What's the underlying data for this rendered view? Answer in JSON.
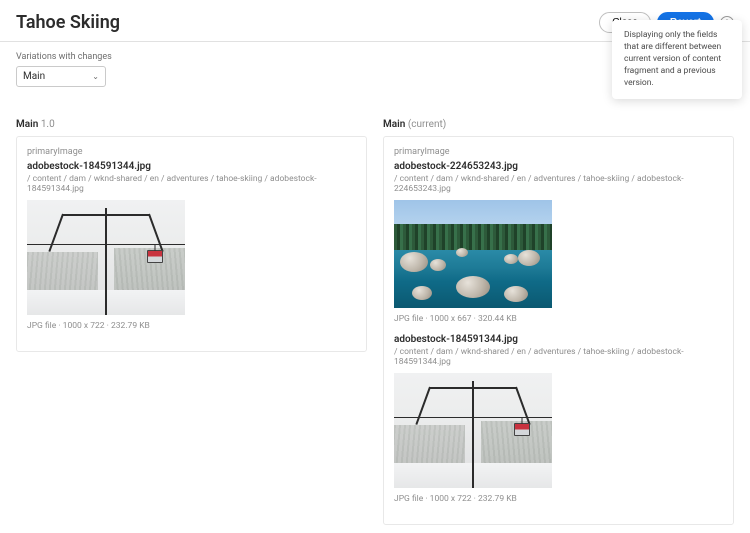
{
  "header": {
    "title": "Tahoe Skiing",
    "close_label": "Close",
    "revert_label": "Revert",
    "tooltip": "Displaying only the fields that are different between current version of content fragment and a previous version."
  },
  "controls": {
    "variations_label": "Variations with changes",
    "selected_variation": "Main"
  },
  "left": {
    "heading_main": "Main",
    "heading_sub": "1.0",
    "property_label": "primaryImage",
    "asset": {
      "filename": "adobestock-184591344.jpg",
      "filepath": "/ content / dam / wknd-shared / en / adventures / tahoe-skiing / adobestock-184591344.jpg",
      "caption": "JPG file · 1000 x 722 · 232.79 KB"
    }
  },
  "right": {
    "heading_main": "Main",
    "heading_sub": "(current)",
    "property_label": "primaryImage",
    "asset_new": {
      "filename": "adobestock-224653243.jpg",
      "filepath": "/ content / dam / wknd-shared / en / adventures / tahoe-skiing / adobestock-224653243.jpg",
      "caption": "JPG file · 1000 x 667 · 320.44 KB"
    },
    "asset_old": {
      "filename": "adobestock-184591344.jpg",
      "filepath": "/ content / dam / wknd-shared / en / adventures / tahoe-skiing / adobestock-184591344.jpg",
      "caption": "JPG file · 1000 x 722 · 232.79 KB"
    }
  }
}
